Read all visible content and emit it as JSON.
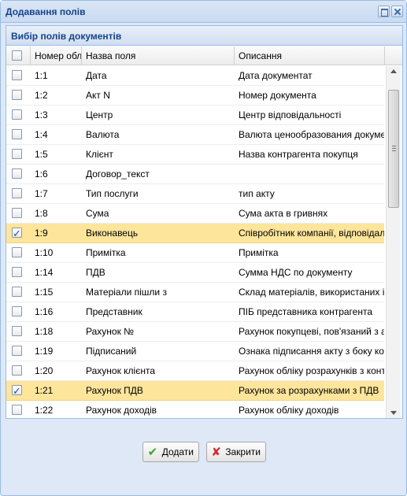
{
  "window": {
    "title": "Додавання полів"
  },
  "panel": {
    "title": "Вибір полів документів"
  },
  "columns": {
    "num": "Номер обл",
    "name": "Назва поля",
    "desc": "Описання"
  },
  "rows": [
    {
      "num": "1:1",
      "name": "Дата",
      "desc": "Дата документат",
      "checked": false
    },
    {
      "num": "1:2",
      "name": "Акт N",
      "desc": "Номер документа",
      "checked": false
    },
    {
      "num": "1:3",
      "name": "Центр",
      "desc": "Центр відповідальності",
      "checked": false
    },
    {
      "num": "1:4",
      "name": "Валюта",
      "desc": "Валюта ценообразования докуме",
      "checked": false
    },
    {
      "num": "1:5",
      "name": "Клієнт",
      "desc": "Назва контрагента покупця",
      "checked": false
    },
    {
      "num": "1:6",
      "name": "Договор_текст",
      "desc": "",
      "checked": false
    },
    {
      "num": "1:7",
      "name": "Тип послуги",
      "desc": "тип акту",
      "checked": false
    },
    {
      "num": "1:8",
      "name": "Сума",
      "desc": "Сума акта в гривнях",
      "checked": false
    },
    {
      "num": "1:9",
      "name": "Виконавець",
      "desc": "Співробітник компанії, відповідал",
      "checked": true
    },
    {
      "num": "1:10",
      "name": "Примітка",
      "desc": "Примітка",
      "checked": false
    },
    {
      "num": "1:14",
      "name": "ПДВ",
      "desc": "Сумма НДС по документу",
      "checked": false
    },
    {
      "num": "1:15",
      "name": "Матеріали пішли з",
      "desc": "Склад матеріалів, використаних і",
      "checked": false
    },
    {
      "num": "1:16",
      "name": "Представник",
      "desc": "ПІБ представника контрагента",
      "checked": false
    },
    {
      "num": "1:18",
      "name": "Рахунок №",
      "desc": "Рахунок покупцеві, пов'язаний з а",
      "checked": false
    },
    {
      "num": "1:19",
      "name": "Підписаний",
      "desc": "Ознака підписання акту з боку кон",
      "checked": false
    },
    {
      "num": "1:20",
      "name": "Рахунок клієнта",
      "desc": "Рахунок обліку розрахунків з конт",
      "checked": false
    },
    {
      "num": "1:21",
      "name": "Рахунок ПДВ",
      "desc": "Рахунок за розрахунками з ПДВ",
      "checked": true
    },
    {
      "num": "1:22",
      "name": "Рахунок доходів",
      "desc": "Рахунок обліку доходів",
      "checked": false
    }
  ],
  "buttons": {
    "add": "Додати",
    "close": "Закрити"
  },
  "colors": {
    "selected_row": "#fde59b",
    "title_text": "#15428b",
    "border": "#99bbe8"
  },
  "icons": {
    "add": "check-icon",
    "close": "cross-icon",
    "maximize": "maximize-icon",
    "window_close": "close-icon"
  }
}
